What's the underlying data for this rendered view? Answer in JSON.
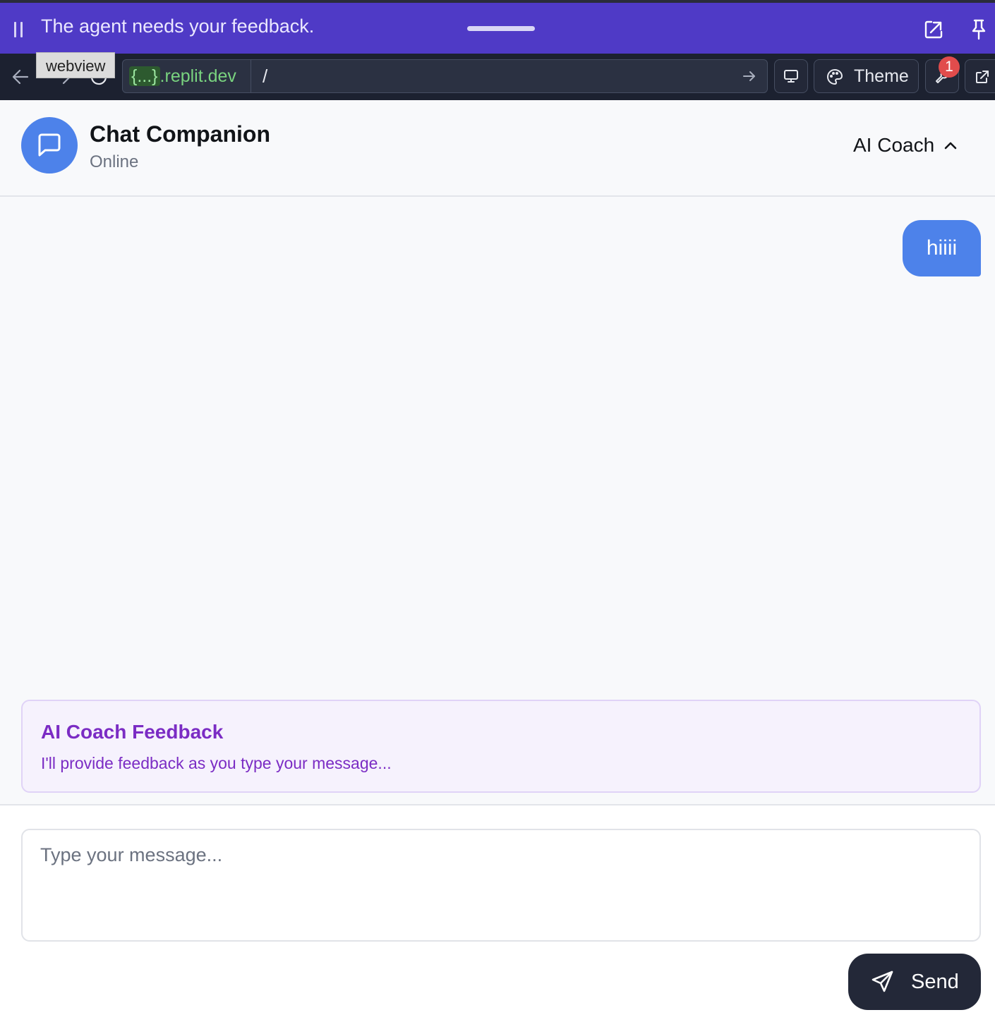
{
  "agent_bar": {
    "message": "The agent needs your feedback."
  },
  "browser": {
    "tooltip": "webview",
    "url_host_tag": "{...}",
    "url_host_rest": ".replit.dev",
    "url_path": "/",
    "theme_label": "Theme",
    "devtools_badge": "1"
  },
  "header": {
    "title": "Chat Companion",
    "status": "Online",
    "mode_label": "AI Coach"
  },
  "messages": [
    {
      "role": "user",
      "text": "hiiii"
    }
  ],
  "feedback": {
    "title": "AI Coach Feedback",
    "text": "I'll provide feedback as you type your message..."
  },
  "composer": {
    "placeholder": "Type your message...",
    "value": "",
    "send_label": "Send"
  },
  "colors": {
    "agent_bar": "#4f3ac6",
    "toolbar": "#1c2130",
    "accent": "#4d82ea",
    "feedback_text": "#7b2cc4",
    "send_button": "#232838"
  }
}
